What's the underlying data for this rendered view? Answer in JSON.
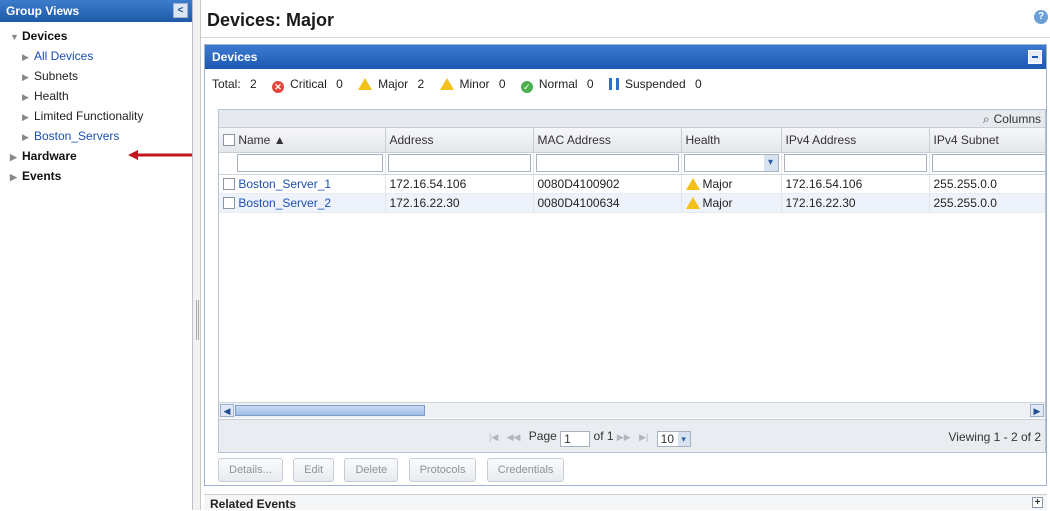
{
  "sidebar": {
    "title": "Group Views",
    "items": [
      {
        "label": "Devices",
        "level": "top",
        "expanded": true
      },
      {
        "label": "All Devices",
        "level": "child",
        "link": true
      },
      {
        "label": "Subnets",
        "level": "child",
        "link": false
      },
      {
        "label": "Health",
        "level": "child",
        "link": false
      },
      {
        "label": "Limited Functionality",
        "level": "child",
        "link": false
      },
      {
        "label": "Boston_Servers",
        "level": "child",
        "link": true
      },
      {
        "label": "Hardware",
        "level": "top",
        "expanded": false
      },
      {
        "label": "Events",
        "level": "top",
        "expanded": false
      }
    ]
  },
  "main": {
    "title": "Devices: Major",
    "panel_title": "Devices",
    "summary": {
      "total_label": "Total:",
      "total": "2",
      "critical_label": "Critical",
      "critical": "0",
      "major_label": "Major",
      "major": "2",
      "minor_label": "Minor",
      "minor": "0",
      "normal_label": "Normal",
      "normal": "0",
      "suspended_label": "Suspended",
      "suspended": "0"
    },
    "columns_label": "Columns",
    "table": {
      "headers": [
        "Name ▲",
        "Address",
        "MAC Address",
        "Health",
        "IPv4 Address",
        "IPv4 Subnet"
      ],
      "rows": [
        {
          "name": "Boston_Server_1",
          "address": "172.16.54.106",
          "mac": "0080D4100902",
          "health": "Major",
          "ipv4": "172.16.54.106",
          "subnet": "255.255.0.0"
        },
        {
          "name": "Boston_Server_2",
          "address": "172.16.22.30",
          "mac": "0080D4100634",
          "health": "Major",
          "ipv4": "172.16.22.30",
          "subnet": "255.255.0.0"
        }
      ]
    },
    "pager": {
      "page_label": "Page",
      "page_value": "1",
      "of_label": "of 1",
      "page_size": "10",
      "viewing": "Viewing 1 - 2 of 2"
    },
    "buttons": [
      "Details...",
      "Edit",
      "Delete",
      "Protocols",
      "Credentials"
    ],
    "related_events": "Related Events"
  },
  "colors": {
    "header_blue": "#1d58b0",
    "link_blue": "#1a4fb5",
    "critical_red": "#e2453c",
    "warning_yellow": "#f2c21b",
    "normal_green": "#4caf50",
    "arrow_red": "#c0171f"
  }
}
